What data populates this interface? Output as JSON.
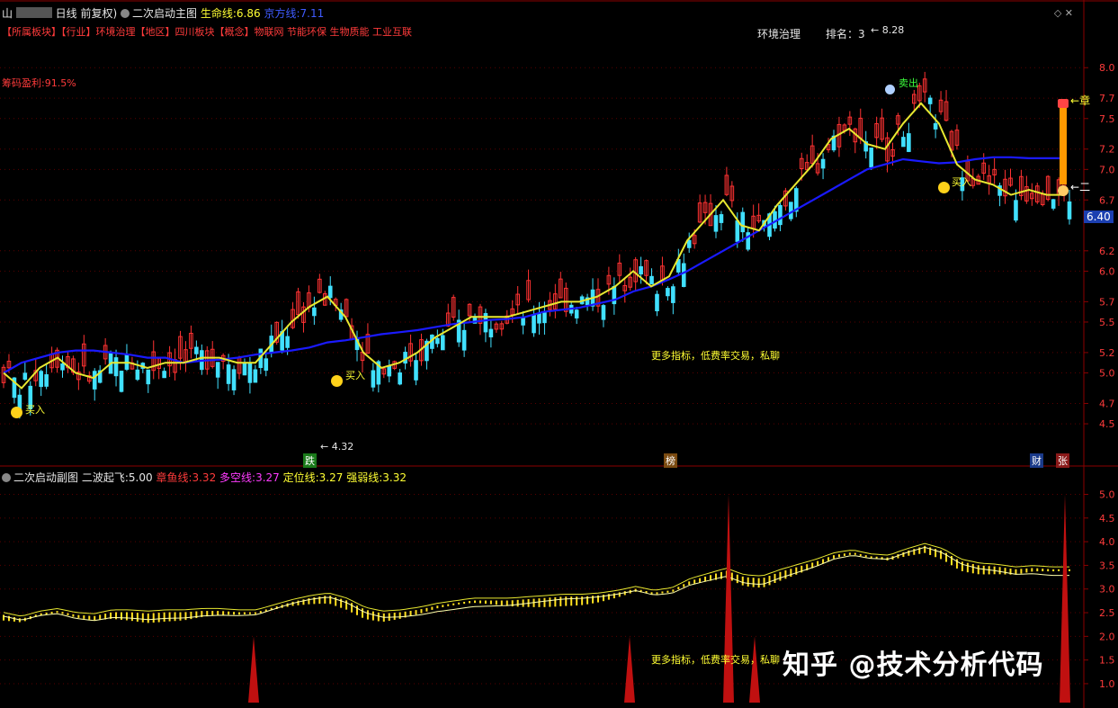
{
  "header": {
    "symbol_prefix": "山",
    "period_label": "日线 前复权",
    "main_indicator": "二次启动主图",
    "life_line_label": "生命线:",
    "life_line_value": "6.86",
    "profit_line_label": "京方线:",
    "profit_line_value": "7.11"
  },
  "tags_line": "【所属板块】【行业】环境治理【地区】四川板块【概念】物联网 节能环保 生物质能 工业互联",
  "chip_profit": "筹码盈利:91.5%",
  "industry_rank": {
    "industry": "环境治理",
    "rank_label": "排名：",
    "rank_value": "3"
  },
  "annotations": {
    "high_label": "8.28",
    "low_label": "4.32",
    "current_price": "6.40",
    "sell_label": "卖出",
    "buy_labels": [
      "买入",
      "买入",
      "买入"
    ],
    "ad_text_main": "更多指标，低费率交易，私聊",
    "ad_text_sub": "更多指标，低费率交易，私聊",
    "zhang_label": "章",
    "er_label": "二",
    "bottom_markers": [
      "跌",
      "榜",
      "财",
      "张"
    ]
  },
  "price_axis": [
    "8.0",
    "7.7",
    "7.5",
    "7.2",
    "7.0",
    "6.7",
    "6.2",
    "6.0",
    "5.7",
    "5.5",
    "5.2",
    "5.0",
    "4.7",
    "4.5"
  ],
  "sub_header": {
    "title": "二次启动副图",
    "item1_label": "二波起飞:",
    "item1_value": "5.00",
    "item2_label": "章鱼线:",
    "item2_value": "3.32",
    "item3_label": "多空线:",
    "item3_value": "3.27",
    "item4_label": "定位线:",
    "item4_value": "3.27",
    "item5_label": "强弱线:",
    "item5_value": "3.32"
  },
  "sub_axis": [
    "5.0",
    "4.5",
    "4.0",
    "3.5",
    "3.0",
    "2.5",
    "2.0",
    "1.5",
    "1.0"
  ],
  "watermark": "知乎 @技术分析代码",
  "colors": {
    "up": "#ff3232",
    "down": "#41e0ff",
    "yellow_line": "#e8e830",
    "blue_line": "#1a1aff",
    "axis_red": "#8b0000"
  },
  "chart_data": {
    "type": "line",
    "ylim": [
      4.2,
      8.4
    ],
    "series": [
      {
        "name": "生命线",
        "values": [
          5.0,
          4.85,
          5.05,
          5.15,
          5.0,
          4.95,
          5.1,
          5.1,
          5.05,
          5.1,
          5.1,
          5.15,
          5.15,
          5.1,
          5.1,
          5.3,
          5.5,
          5.65,
          5.75,
          5.55,
          5.2,
          5.05,
          5.1,
          5.2,
          5.35,
          5.45,
          5.55,
          5.55,
          5.55,
          5.6,
          5.65,
          5.7,
          5.7,
          5.75,
          5.85,
          6.0,
          5.85,
          5.95,
          6.3,
          6.5,
          6.7,
          6.45,
          6.4,
          6.65,
          6.85,
          7.05,
          7.3,
          7.4,
          7.25,
          7.2,
          7.45,
          7.65,
          7.45,
          7.05,
          6.9,
          6.85,
          6.75,
          6.8,
          6.75,
          6.75
        ]
      },
      {
        "name": "京方线",
        "values": [
          5.0,
          5.1,
          5.15,
          5.2,
          5.22,
          5.22,
          5.2,
          5.18,
          5.15,
          5.15,
          5.1,
          5.12,
          5.13,
          5.15,
          5.18,
          5.2,
          5.22,
          5.25,
          5.3,
          5.32,
          5.35,
          5.38,
          5.4,
          5.42,
          5.45,
          5.48,
          5.5,
          5.52,
          5.53,
          5.55,
          5.6,
          5.62,
          5.64,
          5.68,
          5.72,
          5.8,
          5.85,
          5.92,
          6.0,
          6.1,
          6.2,
          6.3,
          6.4,
          6.5,
          6.6,
          6.7,
          6.8,
          6.9,
          7.0,
          7.05,
          7.1,
          7.08,
          7.06,
          7.07,
          7.1,
          7.12,
          7.12,
          7.11,
          7.11,
          7.11
        ]
      }
    ]
  }
}
